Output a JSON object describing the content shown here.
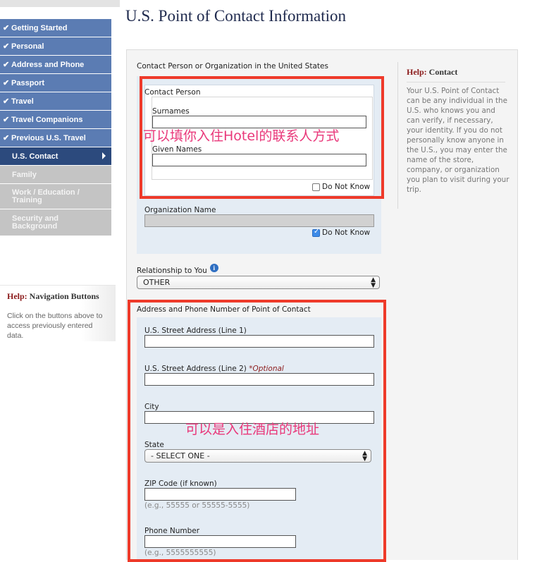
{
  "title": "U.S. Point of Contact Information",
  "nav": {
    "items": [
      {
        "label": "Getting Started",
        "state": "done"
      },
      {
        "label": "Personal",
        "state": "done"
      },
      {
        "label": "Address and Phone",
        "state": "done"
      },
      {
        "label": "Passport",
        "state": "done"
      },
      {
        "label": "Travel",
        "state": "done"
      },
      {
        "label": "Travel Companions",
        "state": "done"
      },
      {
        "label": "Previous U.S. Travel",
        "state": "done"
      },
      {
        "label": "U.S. Contact",
        "state": "current"
      },
      {
        "label": "Family",
        "state": "todo"
      },
      {
        "label": "Work / Education / Training",
        "state": "todo"
      },
      {
        "label": "Security and Background",
        "state": "todo"
      }
    ],
    "check_glyph": "✔"
  },
  "help_nav": {
    "prefix": "Help:",
    "title": "Navigation Buttons",
    "body": "Click on the buttons above to access previously entered data."
  },
  "contact": {
    "section_title": "Contact Person or Organization in the United States",
    "person_title": "Contact Person",
    "surnames_label": "Surnames",
    "surnames_value": "",
    "given_label": "Given Names",
    "given_value": "",
    "dnk_person_label": "Do Not Know",
    "dnk_person_checked": false,
    "org_label": "Organization Name",
    "org_value": "",
    "dnk_org_label": "Do Not Know",
    "dnk_org_checked": true
  },
  "relationship": {
    "label": "Relationship to You",
    "info_glyph": "i",
    "selected": "OTHER"
  },
  "address": {
    "section_title": "Address and Phone Number of Point of Contact",
    "line1_label": "U.S. Street Address (Line 1)",
    "line1_value": "",
    "line2_label": "U.S. Street Address (Line 2)",
    "line2_optional": "*Optional",
    "line2_value": "",
    "city_label": "City",
    "city_value": "",
    "state_label": "State",
    "state_selected": "- SELECT ONE -",
    "zip_label": "ZIP Code (if known)",
    "zip_value": "",
    "zip_hint": "(e.g., 55555 or 55555-5555)",
    "phone_label": "Phone Number",
    "phone_value": "",
    "phone_hint": "(e.g., 5555555555)"
  },
  "help_contact": {
    "prefix": "Help:",
    "title": "Contact",
    "body": "Your U.S. Point of Contact can be any individual in the U.S. who knows you and can verify, if necessary, your identity. If you do not personally know anyone in the U.S., you may enter the name of the store, company, or organization you plan to visit during your trip."
  },
  "annotations": {
    "note1": "可以填你入住Hotel的联系人方式",
    "note2": "可以是入住酒店的地址",
    "color": "#e9387a",
    "box_color": "#ee3a2a"
  },
  "colors": {
    "nav_done": "#5b7cb3",
    "nav_current": "#2c4a7d",
    "nav_todo": "#c4c4c4",
    "title": "#1f2a4e",
    "help_red": "#8b1a1a"
  }
}
